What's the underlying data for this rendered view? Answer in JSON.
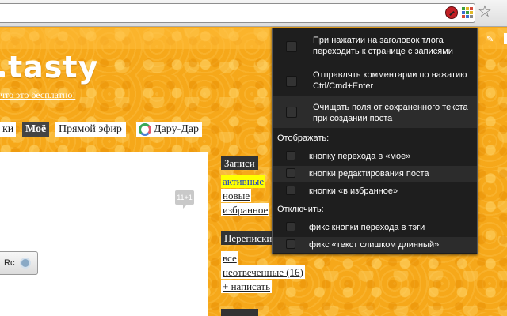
{
  "browser": {
    "star_glyph": "☆",
    "extension_grid_colors": [
      "#3c9f3c",
      "#e0b826",
      "#d34a3a",
      "#3c6fd0",
      "#3c9f3c",
      "#e0b826",
      "#d34a3a",
      "#3c6fd0",
      "#888888"
    ]
  },
  "page": {
    "logo_text": "tasty",
    "tagline": "что это бесплатно!",
    "nav": {
      "tab_1": "ки",
      "tab_mine": "Моё",
      "tab_live": "Прямой эфир",
      "tab_dara": "Дару-Дар"
    },
    "comments_count": "11+1",
    "ro_button": "Rc",
    "sidebar": {
      "records_title": "Записи",
      "records_links": [
        "активные",
        "новые",
        "избранное"
      ],
      "mail_title": "Переписки",
      "mail_links": [
        "все",
        "неотвеченные (16)",
        "+ написать"
      ]
    }
  },
  "popup": {
    "options_top": [
      "При нажатии на заголовок тлога переходить к странице с записями",
      "Отправлять комментарии по нажатию Ctrl/Cmd+Enter",
      "Очищать поля от сохраненного текста при создании поста"
    ],
    "show_title": "Отображать:",
    "show_options": [
      "кнопку перехода в «мое»",
      "кнопки редактирования поста",
      "кнопки «в избранное»"
    ],
    "disable_title": "Отключить:",
    "disable_options": [
      "фикс кнопки перехода в тэги",
      "фикс «текст слишком длинный»"
    ]
  }
}
